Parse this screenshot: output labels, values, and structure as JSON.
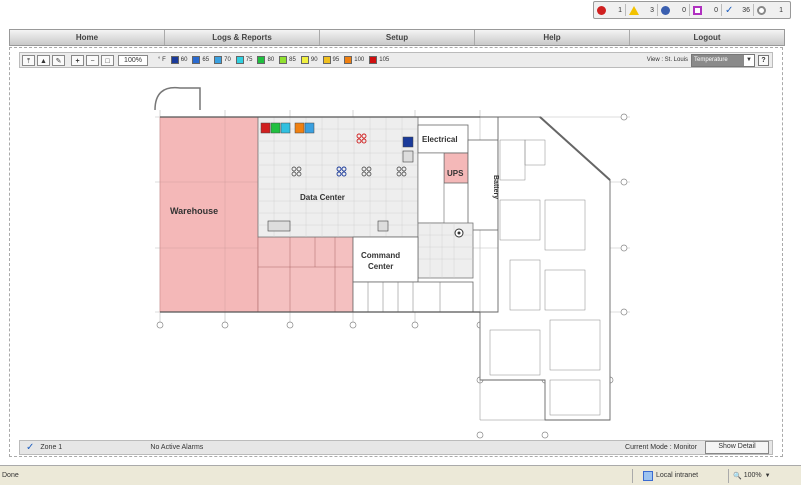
{
  "status_counts": [
    {
      "icon": "critical-icon",
      "value": "1",
      "color": "#d02020"
    },
    {
      "icon": "warning-icon",
      "value": "3",
      "color": "#f2c200"
    },
    {
      "icon": "info-icon",
      "value": "0",
      "color": "#3a5fb0"
    },
    {
      "icon": "maintenance-icon",
      "value": "0",
      "color": "#b030c0"
    },
    {
      "icon": "ok-check-icon",
      "value": "36",
      "color": "#2060c0"
    },
    {
      "icon": "unknown-icon",
      "value": "1",
      "color": "#888888"
    }
  ],
  "nav": [
    "Home",
    "Logs & Reports",
    "Setup",
    "Help",
    "Logout"
  ],
  "toolbar": {
    "zoom": "100%",
    "unit": "° F",
    "legend": [
      {
        "label": "60",
        "color": "#1a3a9a"
      },
      {
        "label": "65",
        "color": "#2a6ad0"
      },
      {
        "label": "70",
        "color": "#3aa0e0"
      },
      {
        "label": "75",
        "color": "#30d0e0"
      },
      {
        "label": "80",
        "color": "#20c040"
      },
      {
        "label": "85",
        "color": "#90e030"
      },
      {
        "label": "90",
        "color": "#f0f040"
      },
      {
        "label": "95",
        "color": "#f0c020"
      },
      {
        "label": "100",
        "color": "#f08010"
      },
      {
        "label": "105",
        "color": "#d01010"
      }
    ],
    "view_label": "View : St. Louis",
    "view_select": "Temperature",
    "help": "?"
  },
  "plan": {
    "rooms": {
      "warehouse": "Warehouse",
      "data_center": "Data Center",
      "electrical": "Electrical",
      "ups": "UPS",
      "battery": "Battery",
      "command_line1": "Command",
      "command_line2": "Center"
    }
  },
  "footer": {
    "zone": "Zone 1",
    "alarms": "No Active Alarms",
    "mode": "Current Mode : Monitor",
    "show_detail": "Show Detail"
  },
  "browser": {
    "status": "Done",
    "zone": "Local intranet",
    "zoom": "100%"
  }
}
